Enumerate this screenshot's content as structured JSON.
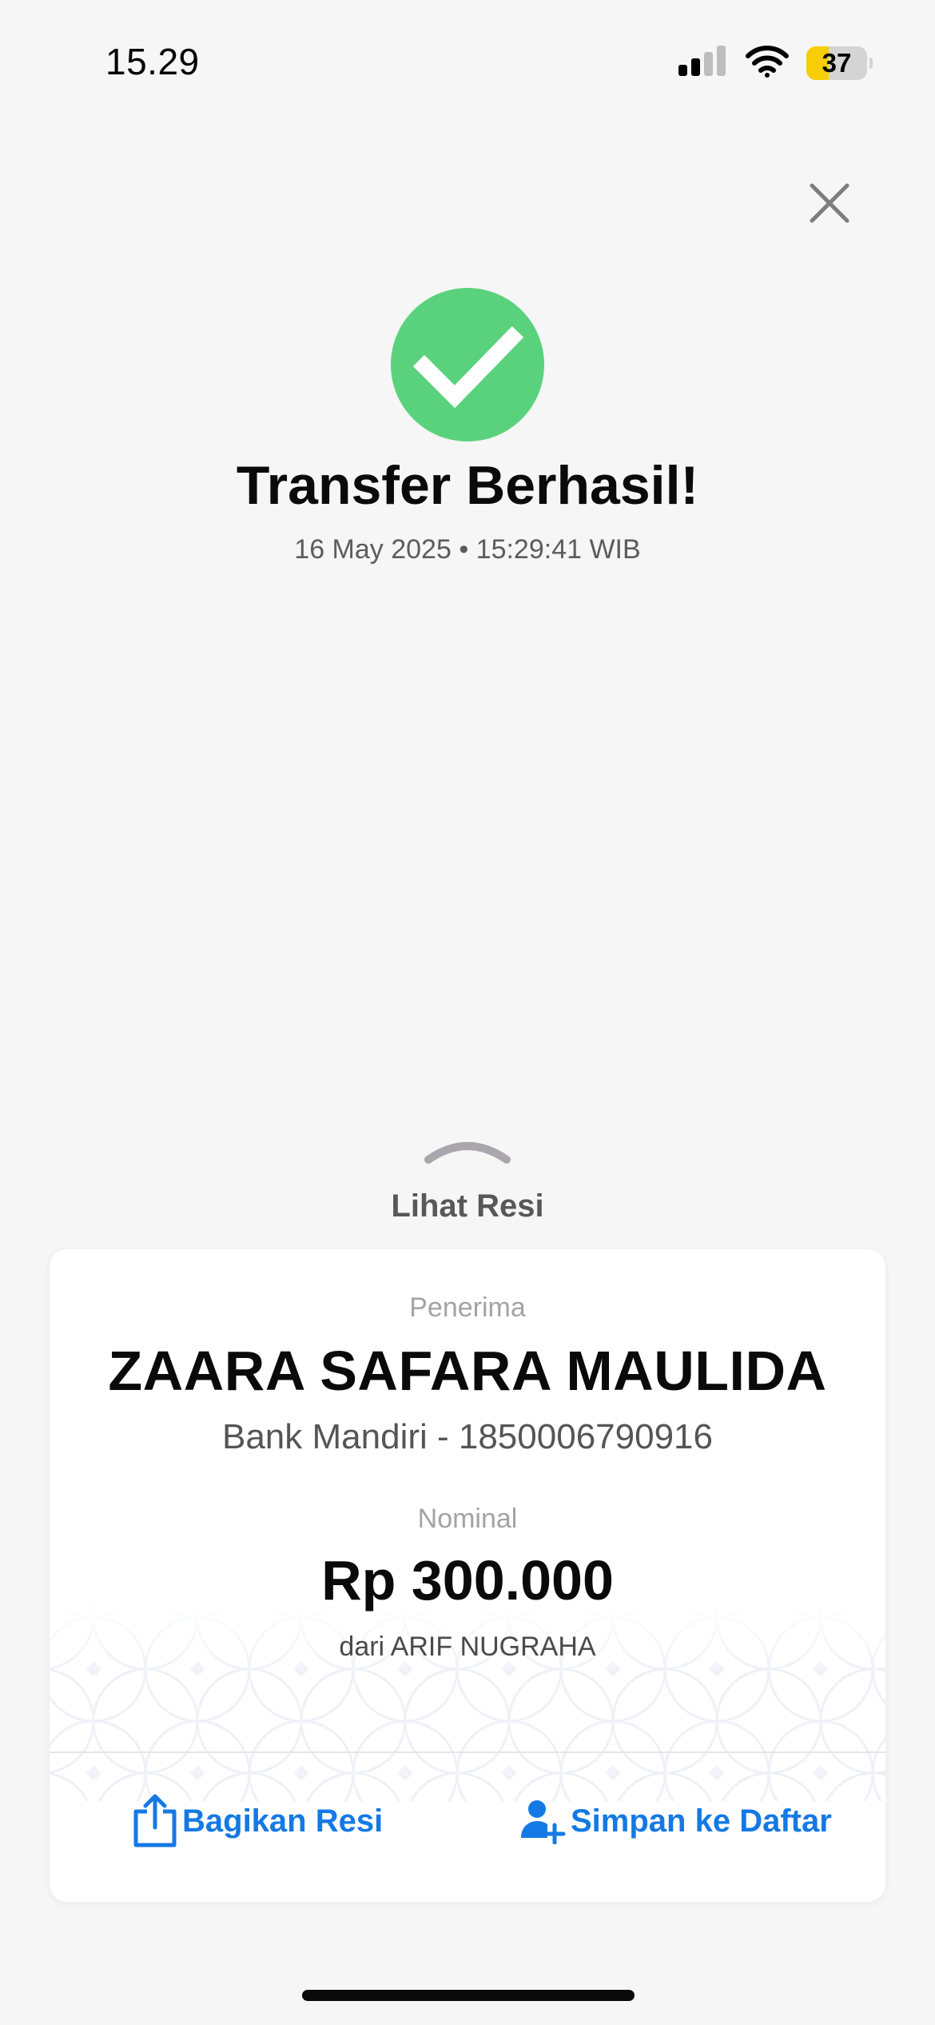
{
  "status_bar": {
    "time": "15.29",
    "battery_level": "37",
    "battery_fraction": 0.37,
    "icons": [
      "signal-icon",
      "wifi-icon",
      "battery-icon"
    ]
  },
  "close": {
    "icon": "close-icon"
  },
  "success": {
    "icon": "check-circle-icon",
    "icon_color": "#5ad27d",
    "title": "Transfer Berhasil!",
    "timestamp": "16 May 2025 • 15:29:41 WIB"
  },
  "receipt_toggle": {
    "icon": "chevron-up-icon",
    "label": "Lihat Resi"
  },
  "receipt": {
    "recipient_label": "Penerima",
    "recipient_name": "ZAARA SAFARA MAULIDA",
    "recipient_account": "Bank Mandiri - 1850006790916",
    "amount_label": "Nominal",
    "amount": "Rp 300.000",
    "sender": "dari ARIF NUGRAHA"
  },
  "actions": {
    "share_label": "Bagikan Resi",
    "share_icon": "share-icon",
    "save_label": "Simpan ke Daftar",
    "save_icon": "add-contact-icon",
    "accent_color": "#1479e4"
  }
}
